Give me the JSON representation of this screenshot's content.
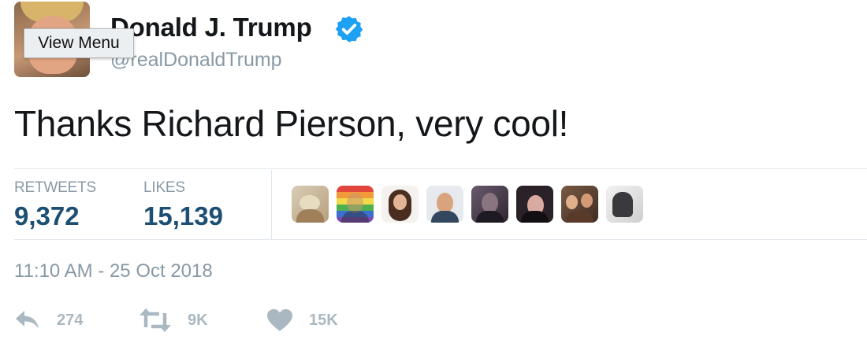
{
  "tooltip": {
    "view_menu": "View Menu"
  },
  "author": {
    "name": "Donald J. Trump",
    "handle": "@realDonaldTrump",
    "verified_color": "#1da1f2"
  },
  "tweet": {
    "text": "Thanks Richard Pierson, very cool!"
  },
  "stats": {
    "retweets_label": "RETWEETS",
    "retweets_value": "9,372",
    "likes_label": "LIKES",
    "likes_value": "15,139"
  },
  "likers": [
    {
      "icon": "avatar-bird"
    },
    {
      "icon": "avatar-rainbow"
    },
    {
      "icon": "avatar-woman"
    },
    {
      "icon": "avatar-man"
    },
    {
      "icon": "avatar-dark"
    },
    {
      "icon": "avatar-girl"
    },
    {
      "icon": "avatar-group"
    },
    {
      "icon": "avatar-horse"
    }
  ],
  "timestamp": "11:10 AM - 25 Oct 2018",
  "actions": {
    "reply_count": "274",
    "retweet_count": "9K",
    "like_count": "15K"
  },
  "colors": {
    "count_blue": "#1c4f73",
    "muted_gray": "#8899a6",
    "action_gray": "#aab8c2"
  }
}
